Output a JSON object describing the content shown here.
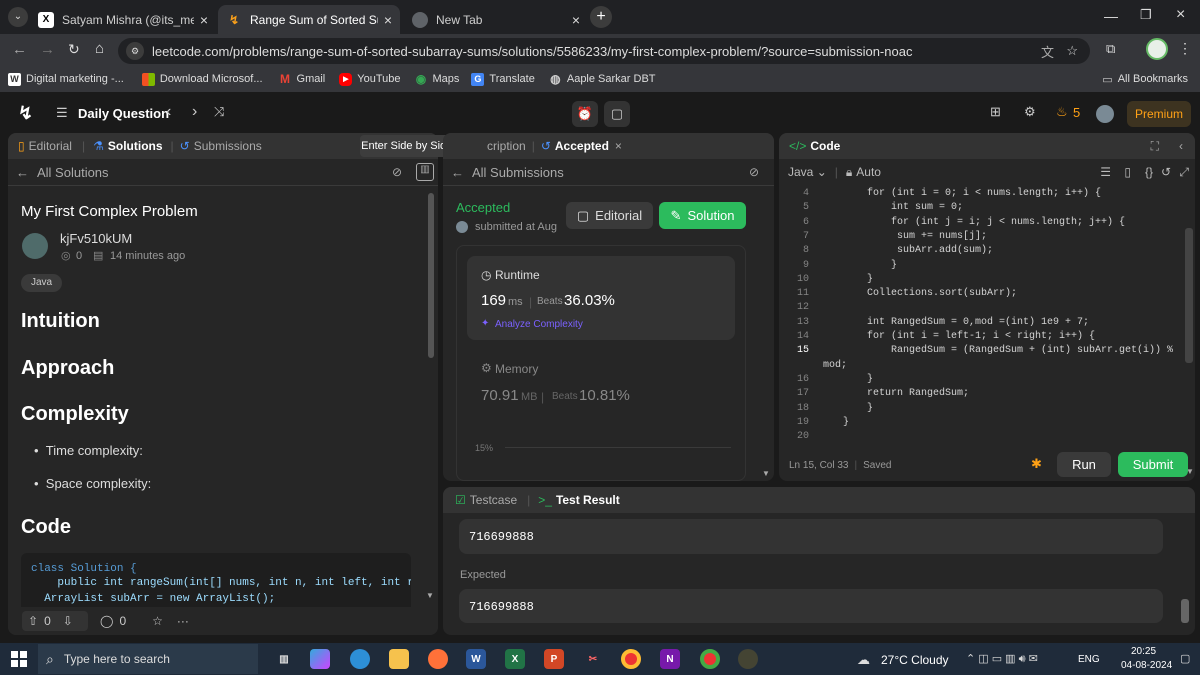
{
  "browser": {
    "tabs": [
      {
        "title": "Satyam Mishra (@its_me_mishra",
        "active": false
      },
      {
        "title": "Range Sum of Sorted Subarray",
        "active": true
      },
      {
        "title": "New Tab",
        "active": false
      }
    ],
    "url": "leetcode.com/problems/range-sum-of-sorted-subarray-sums/solutions/5586233/my-first-complex-problem/?source=submission-noac",
    "bookmarks": [
      {
        "label": "Digital marketing -...",
        "icon": "w-icon"
      },
      {
        "label": "Download Microsof...",
        "icon": "windows-icon"
      },
      {
        "label": "Gmail",
        "icon": "gmail-icon"
      },
      {
        "label": "YouTube",
        "icon": "youtube-icon"
      },
      {
        "label": "Maps",
        "icon": "maps-icon"
      },
      {
        "label": "Translate",
        "icon": "translate-icon"
      },
      {
        "label": "Aaple Sarkar DBT",
        "icon": "globe-icon"
      }
    ],
    "all_bookmarks": "All Bookmarks"
  },
  "nav": {
    "daily": "Daily Question",
    "streak": "5",
    "premium": "Premium"
  },
  "left": {
    "tabs": [
      "Editorial",
      "Solutions",
      "Submissions"
    ],
    "back": "All Solutions",
    "title": "My First Complex Problem",
    "author": "kjFv510kUM",
    "views": "0",
    "time": "14 minutes ago",
    "tag": "Java",
    "h_intuition": "Intuition",
    "h_approach": "Approach",
    "h_complexity": "Complexity",
    "bullet1": "Time complexity:",
    "bullet2": "Space complexity:",
    "h_code": "Code",
    "code1": "class Solution {",
    "code2": "    public int rangeSum(int[] nums, int n, int left, int righ",
    "code3": "  ArrayList subArr = new ArrayList();",
    "upvotes": "0",
    "comments": "0"
  },
  "tooltip": "Enter Side by Side Mode",
  "middle": {
    "tab_desc": "cription",
    "tab_accepted": "Accepted",
    "back": "All Submissions",
    "status": "Accepted",
    "submitted": "submitted at Aug",
    "editorial_btn": "Editorial",
    "solution_btn": "Solution",
    "runtime_label": "Runtime",
    "runtime_value": "169",
    "runtime_unit": "ms",
    "beats_label": "Beats",
    "runtime_beats": "36.03%",
    "analyze": "Analyze Complexity",
    "memory_label": "Memory",
    "memory_value": "70.91",
    "memory_unit": "MB",
    "memory_beats": "10.81%",
    "chart_tick": "15%"
  },
  "code": {
    "title": "Code",
    "lang": "Java",
    "mode": "Auto",
    "lines": [
      {
        "n": "4",
        "t": "        for (int i = 0; i < nums.length; i++) {"
      },
      {
        "n": "5",
        "t": "            int sum = 0;"
      },
      {
        "n": "6",
        "t": "            for (int j = i; j < nums.length; j++) {"
      },
      {
        "n": "7",
        "t": "             sum += nums[j];"
      },
      {
        "n": "8",
        "t": "             subArr.add(sum);"
      },
      {
        "n": "9",
        "t": "            }"
      },
      {
        "n": "10",
        "t": "        }"
      },
      {
        "n": "11",
        "t": "        Collections.sort(subArr);"
      },
      {
        "n": "12",
        "t": ""
      },
      {
        "n": "13",
        "t": "        int RangedSum = 0,mod =(int) 1e9 + 7;"
      },
      {
        "n": "14",
        "t": "        for (int i = left-1; i < right; i++) {"
      },
      {
        "n": "15",
        "t": "            RangedSum = (RangedSum + (int) subArr.get(i)) %"
      },
      {
        "n": "",
        "t": "mod;"
      },
      {
        "n": "16",
        "t": "        }"
      },
      {
        "n": "17",
        "t": "        return RangedSum;"
      },
      {
        "n": "18",
        "t": "        }"
      },
      {
        "n": "19",
        "t": "    }"
      },
      {
        "n": "20",
        "t": ""
      }
    ],
    "status": "Ln 15, Col 33",
    "saved": "Saved",
    "run": "Run",
    "submit": "Submit"
  },
  "result": {
    "tab_testcase": "Testcase",
    "tab_result": "Test Result",
    "output": "716699888",
    "expected_label": "Expected",
    "expected": "716699888"
  },
  "taskbar": {
    "search": "Type here to search",
    "weather": "27°C  Cloudy",
    "lang": "ENG",
    "time": "20:25",
    "date": "04-08-2024"
  }
}
